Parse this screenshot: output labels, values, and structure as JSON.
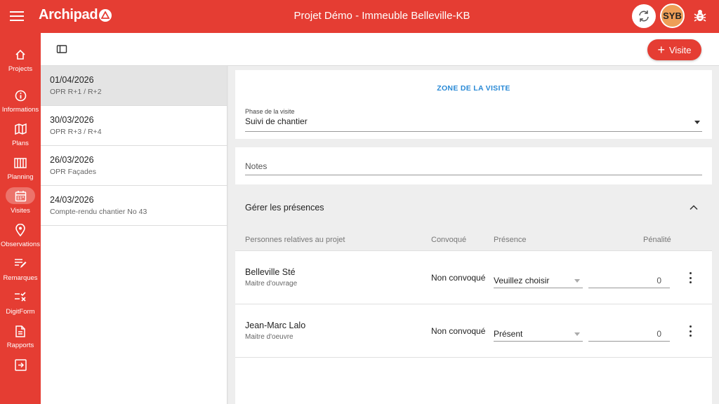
{
  "app": {
    "logo": "Archipad",
    "title": "Projet Démo - Immeuble Belleville-KB"
  },
  "user": {
    "initials": "SYB"
  },
  "colors": {
    "brand": "#e53d33",
    "link": "#2a8ad6",
    "avatar": "#ee9e57"
  },
  "nav": [
    {
      "label": "Projects",
      "icon": "home-icon"
    },
    {
      "label": "Informations",
      "icon": "info-icon"
    },
    {
      "label": "Plans",
      "icon": "map-icon"
    },
    {
      "label": "Planning",
      "icon": "planning-icon"
    },
    {
      "label": "Visites",
      "icon": "calendar-icon",
      "active": true
    },
    {
      "label": "Observations",
      "icon": "location-pin-icon"
    },
    {
      "label": "Remarques",
      "icon": "edit-note-icon"
    },
    {
      "label": "DigitForm",
      "icon": "checklist-icon"
    },
    {
      "label": "Rapports",
      "icon": "document-icon"
    },
    {
      "label": "",
      "icon": "logout-icon"
    }
  ],
  "toolbar": {
    "add_visit_label": "Visite"
  },
  "visits": [
    {
      "date": "01/04/2026",
      "subtitle": "OPR R+1 / R+2",
      "selected": true
    },
    {
      "date": "30/03/2026",
      "subtitle": "OPR R+3 / R+4"
    },
    {
      "date": "26/03/2026",
      "subtitle": "OPR Façades"
    },
    {
      "date": "24/03/2026",
      "subtitle": "Compte-rendu chantier No 43"
    }
  ],
  "detail": {
    "zone_label": "ZONE DE LA VISITE",
    "phase_label": "Phase de la visite",
    "phase_value": "Suivi de chantier",
    "notes_placeholder": "Notes",
    "presences": {
      "title": "Gérer les présences",
      "columns": {
        "person": "Personnes relatives au projet",
        "convoque": "Convoqué",
        "presence": "Présence",
        "penalty": "Pénalité"
      },
      "rows": [
        {
          "name": "Belleville Sté",
          "role": "Maitre d'ouvrage",
          "convoque": "Non convoqué",
          "presence": "Veuillez choisir",
          "penalty": "0"
        },
        {
          "name": "Jean-Marc Lalo",
          "role": "Maitre d'oeuvre",
          "convoque": "Non convoqué",
          "presence": "Présent",
          "penalty": "0"
        }
      ]
    }
  }
}
